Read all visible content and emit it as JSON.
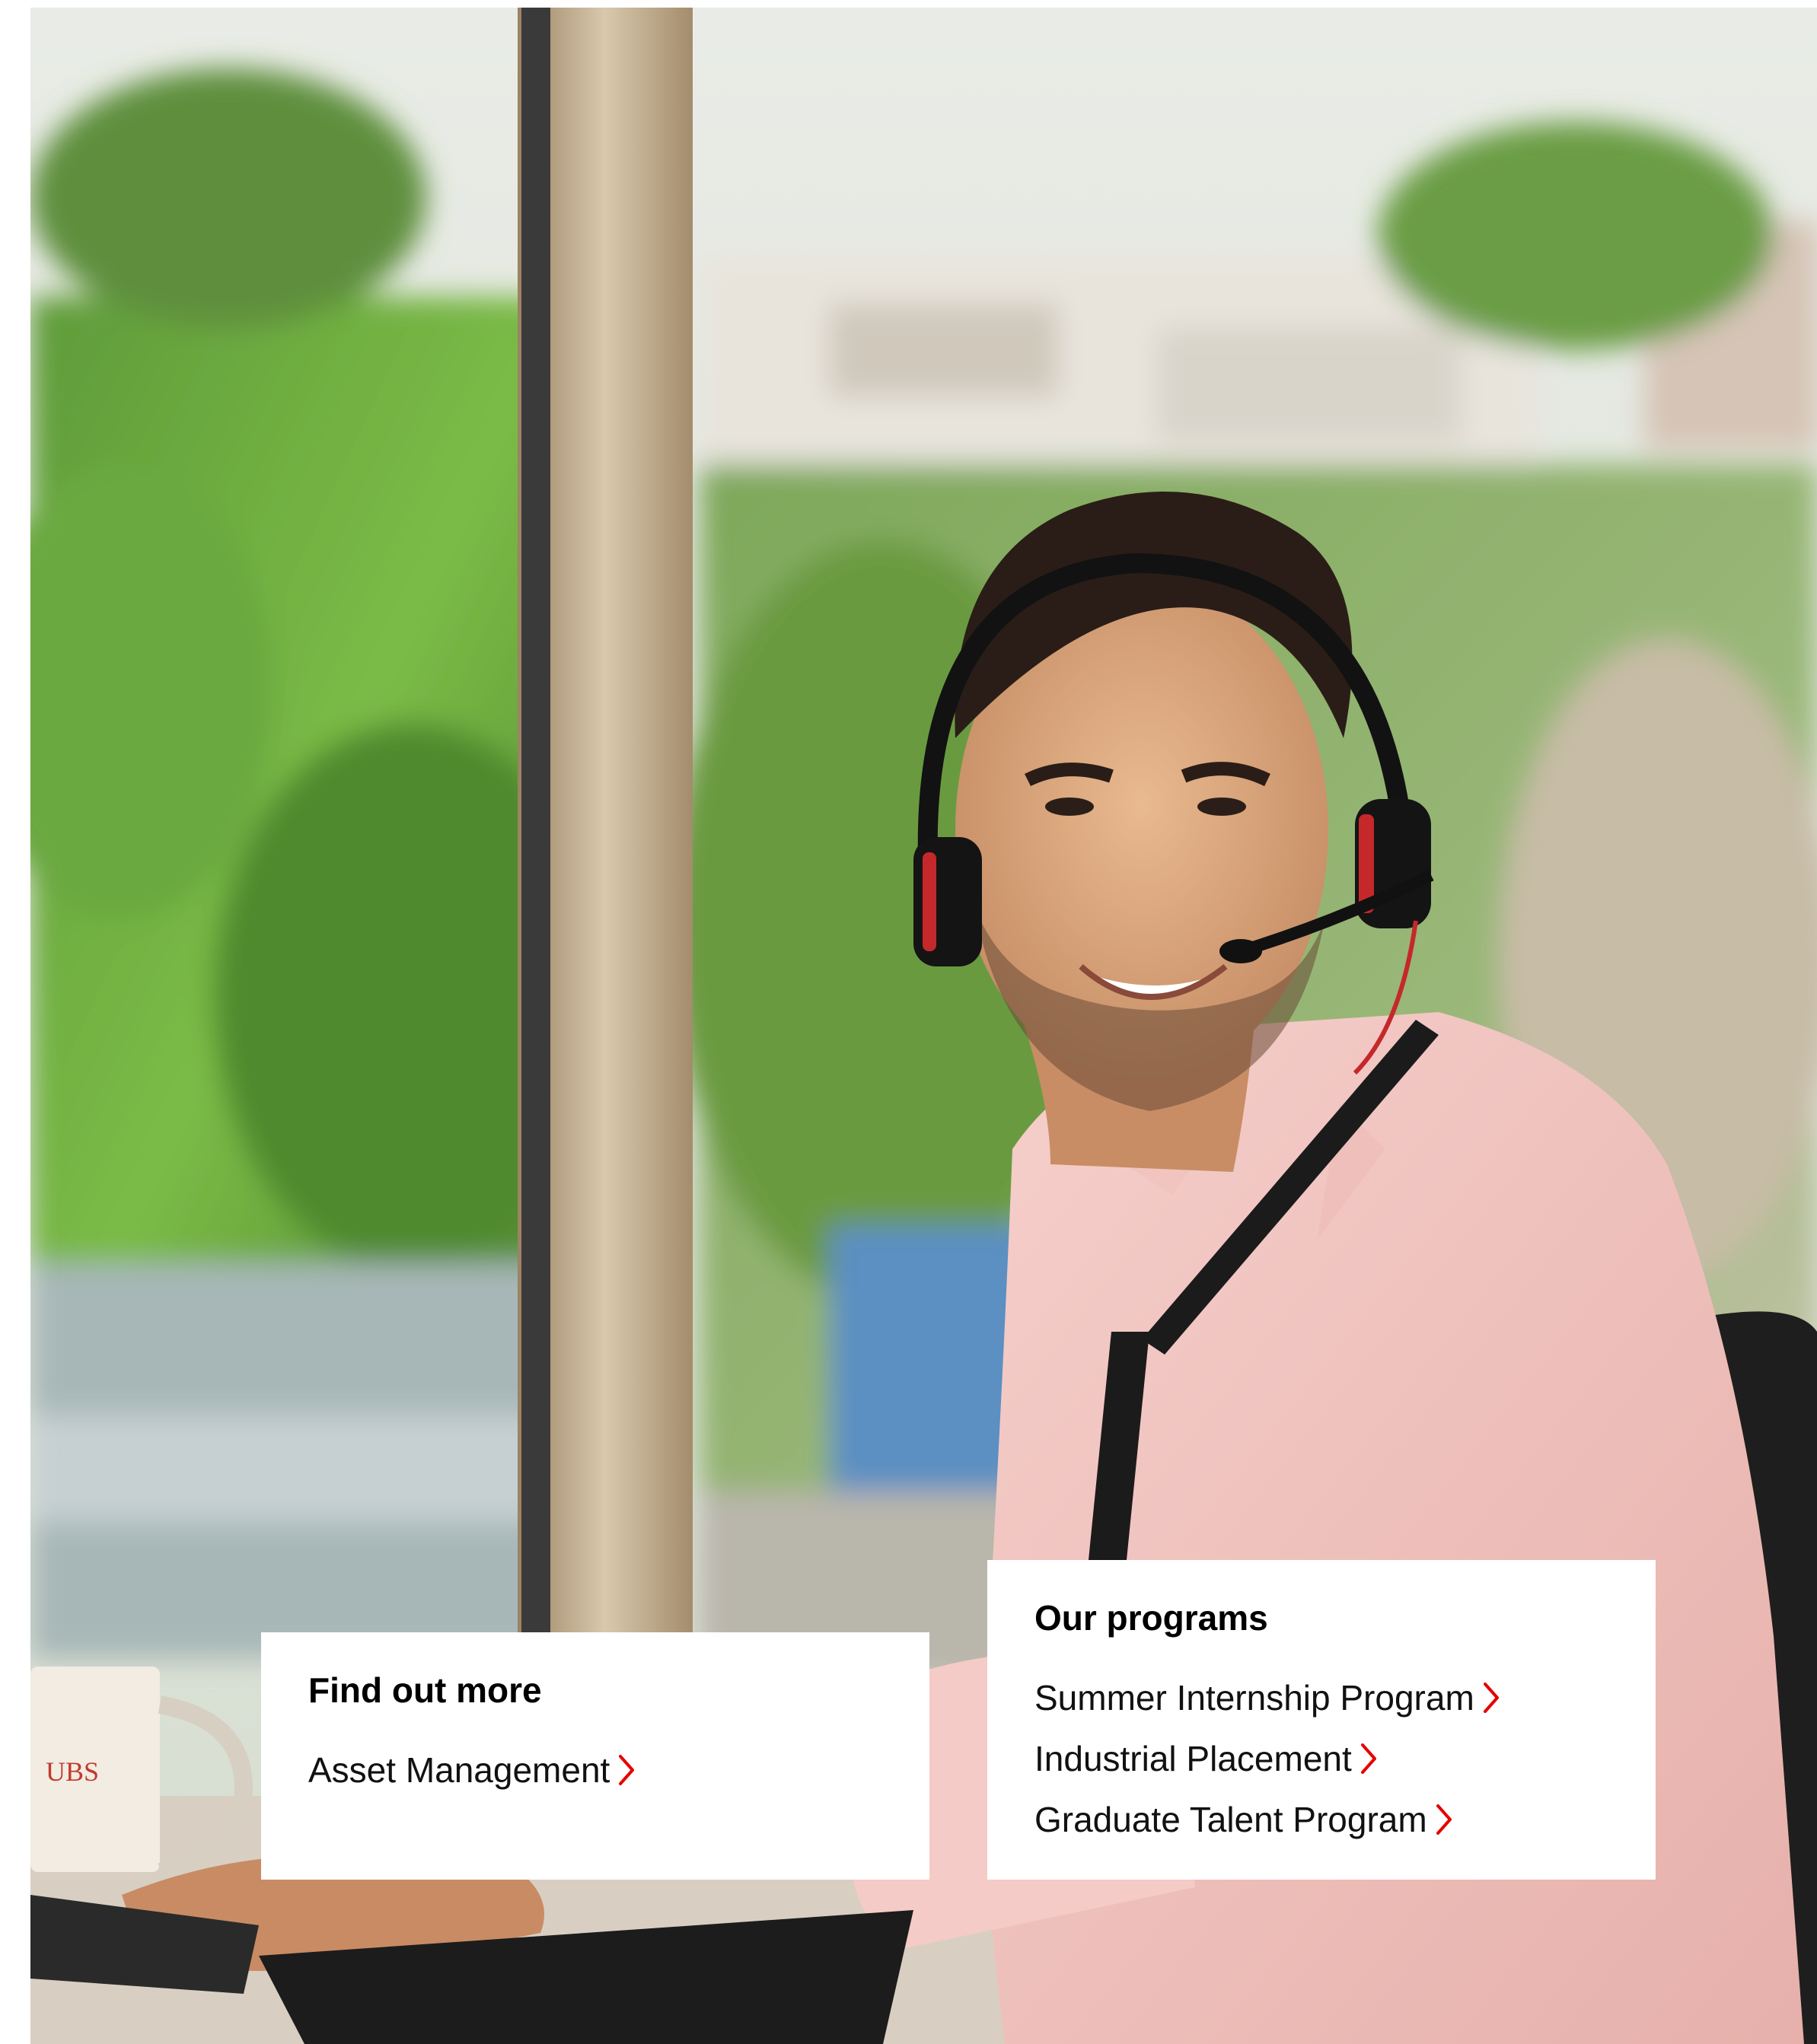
{
  "hero": {
    "image": "man-with-headset-at-office-window",
    "accent_color": "#e60000"
  },
  "find_out_more": {
    "title": "Find out more",
    "links": [
      {
        "label": "Asset Management",
        "icon": "chevron-right-icon"
      }
    ]
  },
  "our_programs": {
    "title": "Our programs",
    "links": [
      {
        "label": "Summer Internship Program",
        "icon": "chevron-right-icon"
      },
      {
        "label": "Industrial Placement",
        "icon": "chevron-right-icon"
      },
      {
        "label": "Graduate Talent Program",
        "icon": "chevron-right-icon"
      }
    ]
  }
}
